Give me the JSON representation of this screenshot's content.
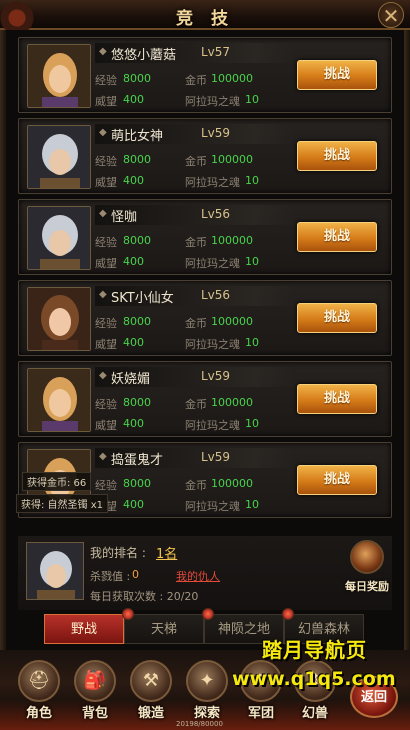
{
  "header": {
    "title": "竞 技",
    "close_icon": "crossed-swords-icon"
  },
  "labels": {
    "exp": "经验",
    "gold": "金币",
    "prestige": "威望",
    "soul": "阿拉玛之魂",
    "challenge": "挑战"
  },
  "opponents": [
    {
      "name": "悠悠小蘑菇",
      "level": "Lv57",
      "exp": "8000",
      "gold": "100000",
      "prestige": "400",
      "soul": "10",
      "avatar": "blonde-female"
    },
    {
      "name": "萌比女神",
      "level": "Lv59",
      "exp": "8000",
      "gold": "100000",
      "prestige": "400",
      "soul": "10",
      "avatar": "silver-male"
    },
    {
      "name": "怪咖",
      "level": "Lv56",
      "exp": "8000",
      "gold": "100000",
      "prestige": "400",
      "soul": "10",
      "avatar": "silver-male"
    },
    {
      "name": "SKT小仙女",
      "level": "Lv56",
      "exp": "8000",
      "gold": "100000",
      "prestige": "400",
      "soul": "10",
      "avatar": "brunette-female"
    },
    {
      "name": "妖娆媚",
      "level": "Lv59",
      "exp": "8000",
      "gold": "100000",
      "prestige": "400",
      "soul": "10",
      "avatar": "blonde-female"
    },
    {
      "name": "捣蛋鬼才",
      "level": "Lv59",
      "exp": "8000",
      "gold": "100000",
      "prestige": "400",
      "soul": "10",
      "avatar": "blonde-female"
    }
  ],
  "reward_log": [
    "获得金币: 66",
    "获得: 自然圣镯 x1"
  ],
  "me": {
    "rank_label": "我的排名 :",
    "rank_value": "1名",
    "kill_label": "杀戮值 :",
    "kill_value": "0",
    "enemy_link": "我的仇人",
    "daily_label": "每日获取次数 : 20/20",
    "daily_reward": "每日奖励"
  },
  "tabs": [
    "野战",
    "天梯",
    "神陨之地",
    "幻兽森林"
  ],
  "active_tab": "野战",
  "bottom_menu": [
    {
      "label": "角色",
      "icon": "helmet-icon"
    },
    {
      "label": "背包",
      "icon": "backpack-icon"
    },
    {
      "label": "锻造",
      "icon": "anvil-icon"
    },
    {
      "label": "探索",
      "icon": "compass-icon"
    },
    {
      "label": "军团",
      "icon": "banner-icon"
    },
    {
      "label": "幻兽",
      "icon": "beast-icon"
    }
  ],
  "exp_bar_text": "20198/80000",
  "back_button": "返回",
  "watermark": {
    "cn": "踏月导航页",
    "url": "www.q1q5.com"
  },
  "colors": {
    "accent_gold": "#f3c34d",
    "value_green": "#49d34b",
    "button_orange": "#d57b18",
    "tab_red": "#b8322a"
  }
}
